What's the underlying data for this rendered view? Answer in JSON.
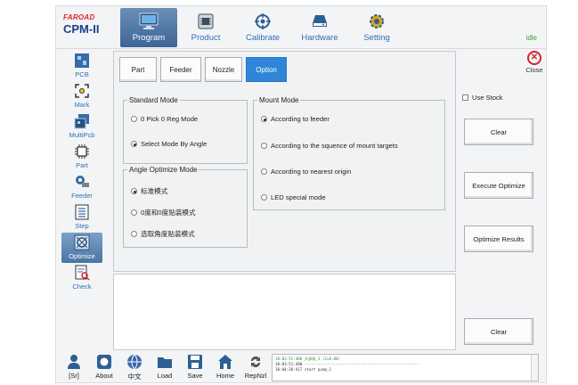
{
  "brand": {
    "maker": "FAROAD",
    "model": "CPM-II"
  },
  "topnav": [
    {
      "label": "Program",
      "icon": "monitor-icon",
      "active": true
    },
    {
      "label": "Product",
      "icon": "board-icon"
    },
    {
      "label": "Calibrate",
      "icon": "crosshair-icon"
    },
    {
      "label": "Hardware",
      "icon": "drive-icon"
    },
    {
      "label": "Setting",
      "icon": "gear-icon"
    }
  ],
  "status": "idle",
  "sidebar": [
    {
      "label": "PCB",
      "icon": "pcb-icon"
    },
    {
      "label": "Mark",
      "icon": "mark-icon"
    },
    {
      "label": "MultiPcb",
      "icon": "multipcb-icon"
    },
    {
      "label": "Part",
      "icon": "chip-icon"
    },
    {
      "label": "Feeder",
      "icon": "feeder-icon"
    },
    {
      "label": "Step",
      "icon": "list-icon"
    },
    {
      "label": "Optimize",
      "icon": "optimize-icon",
      "active": true
    },
    {
      "label": "Check",
      "icon": "check-doc-icon"
    }
  ],
  "subtabs": [
    {
      "label": "Part"
    },
    {
      "label": "Feeder"
    },
    {
      "label": "Nozzle"
    },
    {
      "label": "Option",
      "active": true
    }
  ],
  "standard_mode": {
    "title": "Standard Mode",
    "options": [
      {
        "label": "0 Pick 0 Reg Mode",
        "selected": false
      },
      {
        "label": "Select Mode By Angle",
        "selected": true
      }
    ]
  },
  "angle_mode": {
    "title": "Angle Optimize Mode",
    "options": [
      {
        "label": "标准模式",
        "selected": true
      },
      {
        "label": "0度和0度贴装模式",
        "selected": false
      },
      {
        "label": "选取角度贴装模式",
        "selected": false
      }
    ]
  },
  "mount_mode": {
    "title": "Mount Mode",
    "options": [
      {
        "label": "According to feeder",
        "selected": true
      },
      {
        "label": "According to the squence of mount targets",
        "selected": false
      },
      {
        "label": "According to nearest origin",
        "selected": false
      },
      {
        "label": "LED special mode",
        "selected": false
      }
    ]
  },
  "right": {
    "close": "Close",
    "use_stock": "Use Stock",
    "clear1": "Clear",
    "execute": "Execute Optimize",
    "results": "Optimize Results",
    "clear2": "Clear"
  },
  "bottom": [
    {
      "label": "[Sr]",
      "icon": "user-icon"
    },
    {
      "label": "About",
      "icon": "info-icon"
    },
    {
      "label": "中文",
      "icon": "language-icon"
    },
    {
      "label": "Load",
      "icon": "folder-icon"
    },
    {
      "label": "Save",
      "icon": "save-icon"
    },
    {
      "label": "Home",
      "icon": "home-icon"
    },
    {
      "label": "RepNzl",
      "icon": "replace-nozzle-icon"
    }
  ],
  "console": [
    "10:03:51:400 头部吸_3 (Z=0.00)",
    "10:03:51:400 ---------------------------------------------------",
    "10:04:38:417 start pump_1"
  ]
}
